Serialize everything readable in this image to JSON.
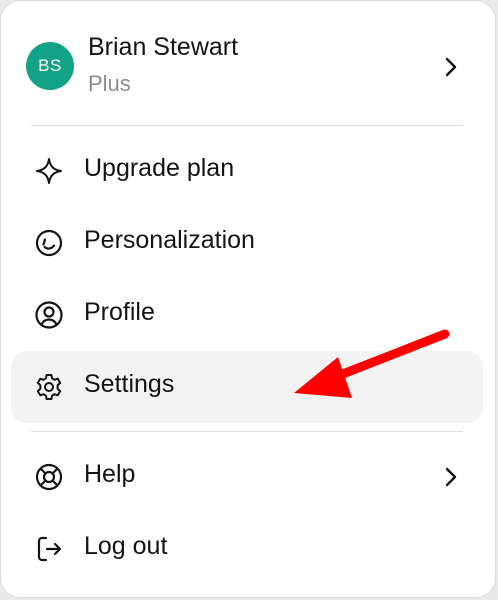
{
  "account": {
    "avatar_initials": "BS",
    "avatar_color": "#12a386",
    "name": "Brian Stewart",
    "plan": "Plus",
    "chevron_icon": "chevron-right-icon"
  },
  "menu": {
    "items": [
      {
        "label": "Upgrade plan",
        "icon": "sparkle-icon"
      },
      {
        "label": "Personalization",
        "icon": "personalization-icon"
      },
      {
        "label": "Profile",
        "icon": "profile-icon"
      },
      {
        "label": "Settings",
        "icon": "gear-icon",
        "highlighted": true
      }
    ],
    "footer_items": [
      {
        "label": "Help",
        "icon": "lifebuoy-icon",
        "has_submenu": true
      },
      {
        "label": "Log out",
        "icon": "logout-icon"
      }
    ]
  },
  "annotation": {
    "arrow_color": "#ff0000",
    "points_to": "Settings"
  }
}
